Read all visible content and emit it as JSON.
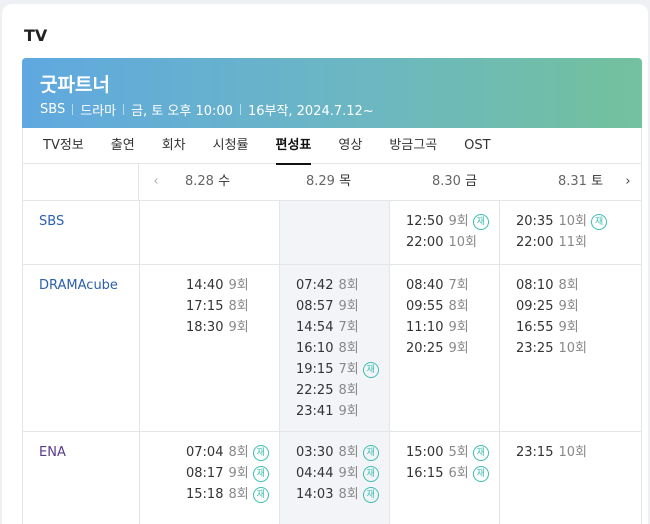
{
  "section_title": "TV",
  "program": {
    "title": "굿파트너",
    "meta": [
      "SBS",
      "드라마",
      "금, 토 오후 10:00",
      "16부작, 2024.7.12~"
    ]
  },
  "tabs": [
    "TV정보",
    "출연",
    "회차",
    "시청률",
    "편성표",
    "영상",
    "방금그곡",
    "OST"
  ],
  "active_tab": "편성표",
  "dates": [
    {
      "date": "8.28",
      "day": "수"
    },
    {
      "date": "8.29",
      "day": "목"
    },
    {
      "date": "8.30",
      "day": "금"
    },
    {
      "date": "8.31",
      "day": "토"
    }
  ],
  "rerun_label": "재",
  "schedule": [
    {
      "channel": "SBS",
      "cols": [
        [],
        [],
        [
          {
            "time": "12:50",
            "ep": "9회",
            "rerun": true
          },
          {
            "time": "22:00",
            "ep": "10회",
            "rerun": false
          }
        ],
        [
          {
            "time": "20:35",
            "ep": "10회",
            "rerun": true
          },
          {
            "time": "22:00",
            "ep": "11회",
            "rerun": false
          }
        ]
      ]
    },
    {
      "channel": "DRAMAcube",
      "cols": [
        [
          {
            "time": "14:40",
            "ep": "9회",
            "rerun": false
          },
          {
            "time": "17:15",
            "ep": "8회",
            "rerun": false
          },
          {
            "time": "18:30",
            "ep": "9회",
            "rerun": false
          }
        ],
        [
          {
            "time": "07:42",
            "ep": "8회",
            "rerun": false
          },
          {
            "time": "08:57",
            "ep": "9회",
            "rerun": false
          },
          {
            "time": "14:54",
            "ep": "7회",
            "rerun": false
          },
          {
            "time": "16:10",
            "ep": "8회",
            "rerun": false
          },
          {
            "time": "19:15",
            "ep": "7회",
            "rerun": true
          },
          {
            "time": "22:25",
            "ep": "8회",
            "rerun": false
          },
          {
            "time": "23:41",
            "ep": "9회",
            "rerun": false
          }
        ],
        [
          {
            "time": "08:40",
            "ep": "7회",
            "rerun": false
          },
          {
            "time": "09:55",
            "ep": "8회",
            "rerun": false
          },
          {
            "time": "11:10",
            "ep": "9회",
            "rerun": false
          },
          {
            "time": "20:25",
            "ep": "9회",
            "rerun": false
          }
        ],
        [
          {
            "time": "08:10",
            "ep": "8회",
            "rerun": false
          },
          {
            "time": "09:25",
            "ep": "9회",
            "rerun": false
          },
          {
            "time": "16:55",
            "ep": "9회",
            "rerun": false
          },
          {
            "time": "23:25",
            "ep": "10회",
            "rerun": false
          }
        ]
      ]
    },
    {
      "channel": "ENA",
      "cols": [
        [
          {
            "time": "07:04",
            "ep": "8회",
            "rerun": true
          },
          {
            "time": "08:17",
            "ep": "9회",
            "rerun": true
          },
          {
            "time": "15:18",
            "ep": "8회",
            "rerun": true
          }
        ],
        [
          {
            "time": "03:30",
            "ep": "8회",
            "rerun": true
          },
          {
            "time": "04:44",
            "ep": "9회",
            "rerun": true
          },
          {
            "time": "14:03",
            "ep": "8회",
            "rerun": true
          }
        ],
        [
          {
            "time": "15:00",
            "ep": "5회",
            "rerun": true
          },
          {
            "time": "16:15",
            "ep": "6회",
            "rerun": true
          }
        ],
        [
          {
            "time": "23:15",
            "ep": "10회",
            "rerun": false
          }
        ]
      ]
    }
  ]
}
